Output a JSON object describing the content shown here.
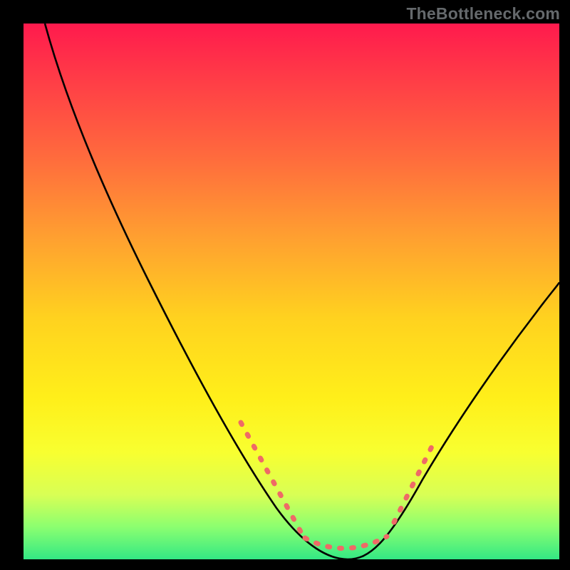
{
  "watermark": "TheBottleneck.com",
  "chart_data": {
    "type": "line",
    "title": "",
    "xlabel": "",
    "ylabel": "",
    "xlim": [
      0,
      100
    ],
    "ylim": [
      0,
      100
    ],
    "grid": false,
    "legend": false,
    "series": [
      {
        "name": "bottleneck-curve",
        "color": "#000000",
        "x": [
          4,
          10,
          18,
          26,
          34,
          40,
          46,
          50,
          54,
          58,
          62,
          66,
          72,
          80,
          88,
          96,
          100
        ],
        "y": [
          100,
          88,
          73,
          58,
          43,
          31,
          19,
          10,
          4,
          1,
          0,
          1,
          4,
          14,
          28,
          42,
          49
        ]
      },
      {
        "name": "highlight-dots-left",
        "color": "#ef6a66",
        "style": "dashed",
        "x": [
          42,
          45,
          48,
          50,
          52
        ],
        "y": [
          26,
          20,
          14,
          9,
          5
        ]
      },
      {
        "name": "highlight-dots-bottom",
        "color": "#ef6a66",
        "style": "dashed",
        "x": [
          54,
          56,
          58,
          60,
          62,
          64,
          66,
          68
        ],
        "y": [
          2.5,
          1.2,
          0.8,
          0.6,
          0.6,
          1.0,
          1.8,
          3.0
        ]
      },
      {
        "name": "highlight-dots-right",
        "color": "#ef6a66",
        "style": "dashed",
        "x": [
          70,
          72,
          74,
          76
        ],
        "y": [
          6,
          10,
          15,
          20
        ]
      }
    ]
  }
}
